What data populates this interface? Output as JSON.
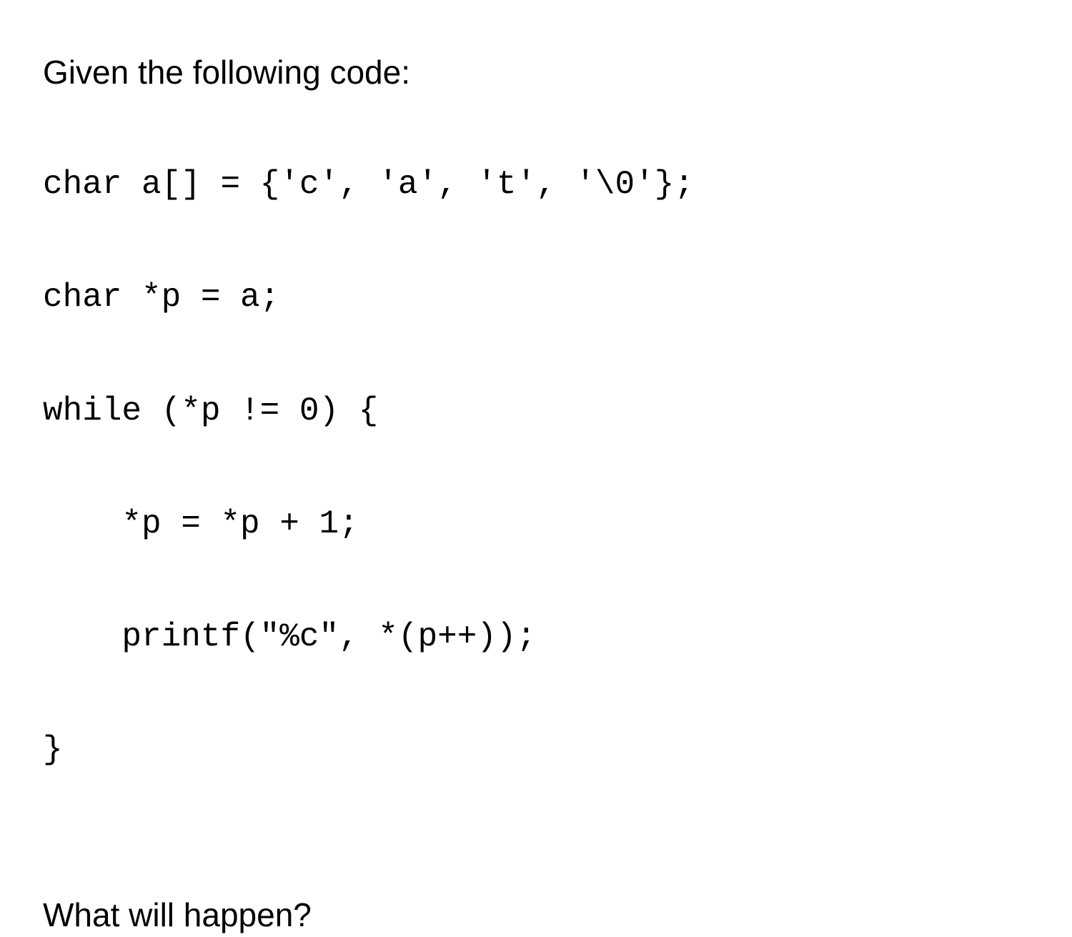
{
  "intro": "Given the following code:",
  "code": {
    "l1": "char a[] = {'c', 'a', 't', '\\0'};",
    "l2": "char *p = a;",
    "l3": "while (*p != 0) {",
    "l4": "    *p = *p + 1;",
    "l5": "    printf(\"%c\", *(p++));",
    "l6": "}"
  },
  "question": "What will happen?"
}
